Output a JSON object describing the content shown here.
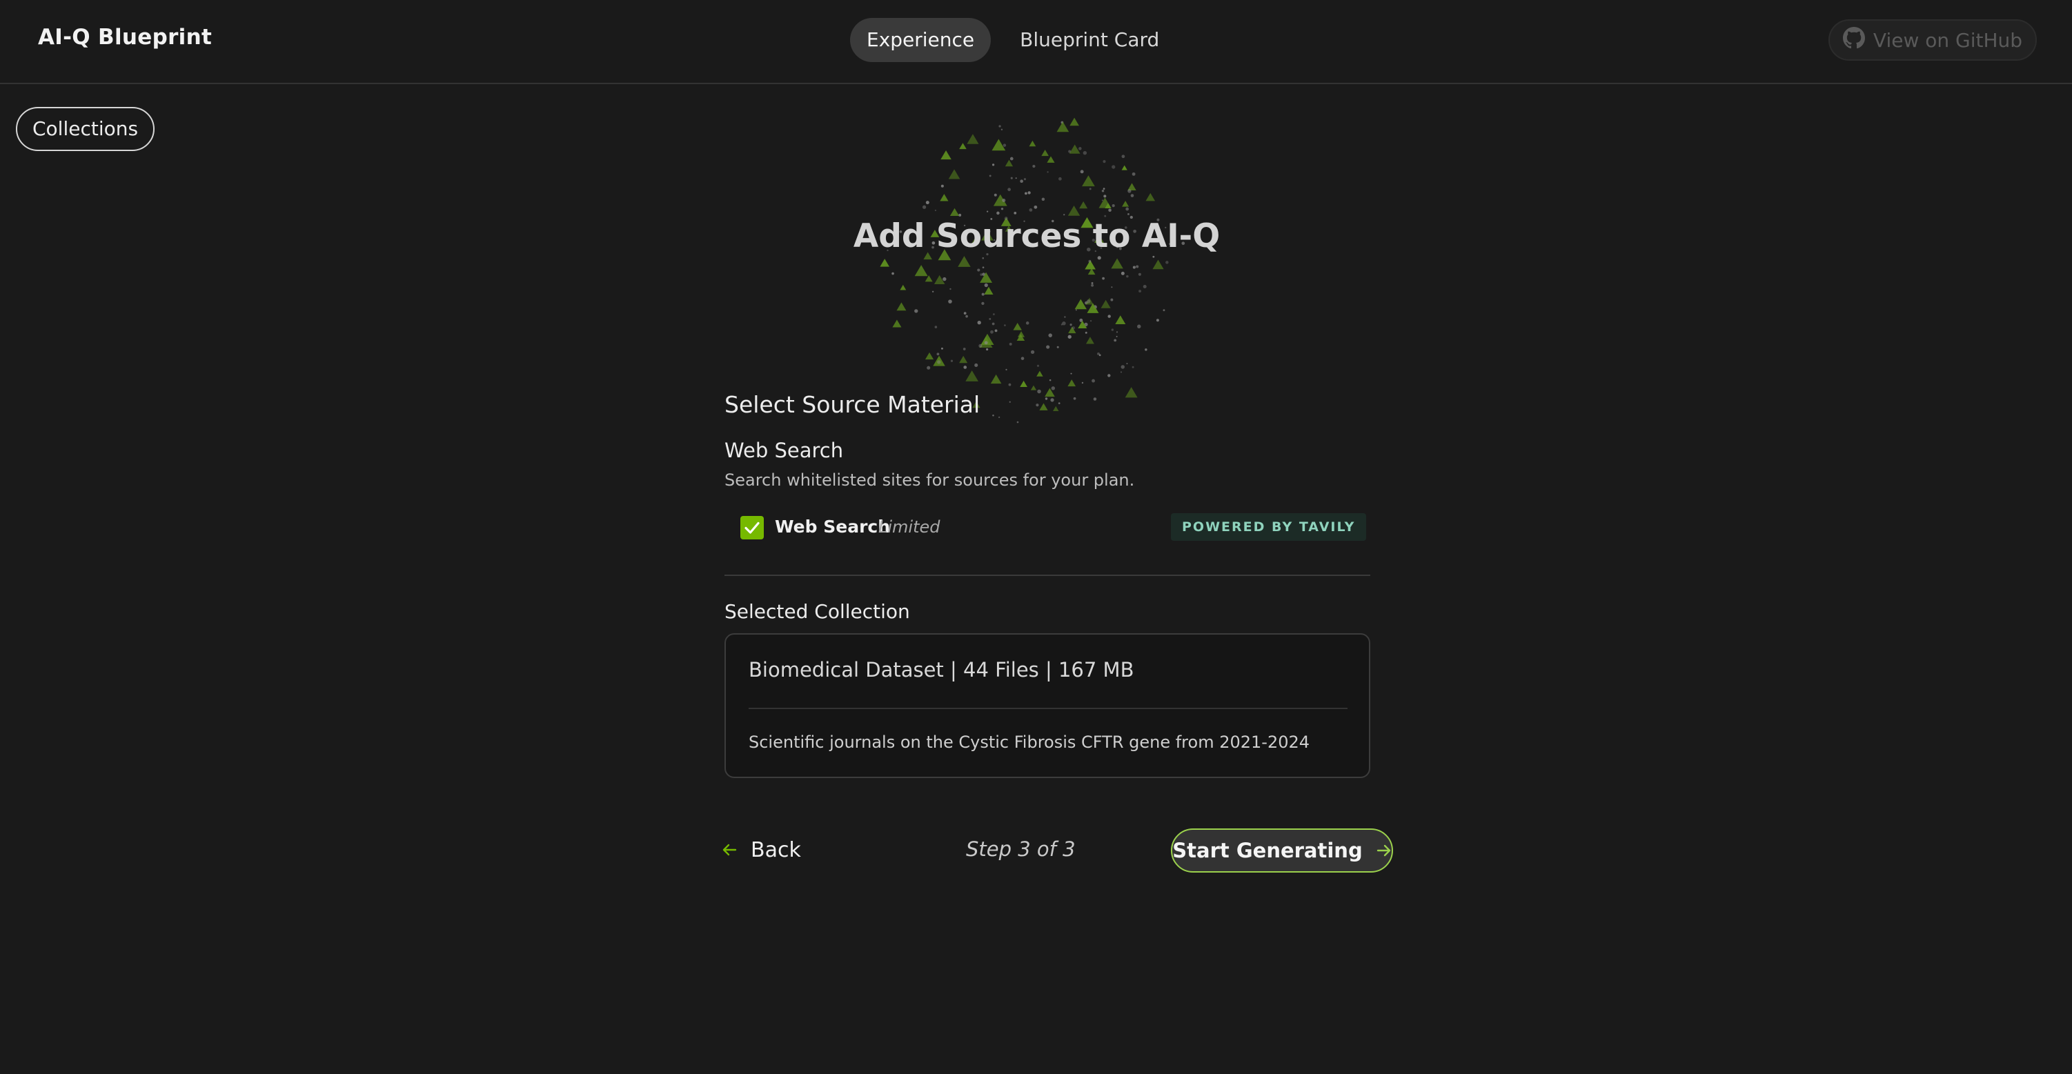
{
  "header": {
    "brand": "AI-Q Blueprint",
    "tabs": [
      {
        "label": "Experience",
        "active": true
      },
      {
        "label": "Blueprint Card",
        "active": false
      }
    ],
    "github_label": "View on GitHub",
    "github_icon": "github-icon"
  },
  "sidebar": {
    "collections_label": "Collections"
  },
  "hero": {
    "title": "Add Sources to AI-Q"
  },
  "sources": {
    "section_title": "Select Source Material",
    "web_search": {
      "title": "Web Search",
      "description": "Search whitelisted sites for sources for your plan.",
      "checkbox_label": "Web Search",
      "checkbox_note": "Limited",
      "checked": true,
      "badge": "POWERED BY TAVILY"
    },
    "collection": {
      "label": "Selected Collection",
      "summary": "Biomedical Dataset | 44 Files | 167 MB",
      "description": "Scientific journals on the Cystic Fibrosis CFTR gene from 2021-2024"
    }
  },
  "footer": {
    "back_label": "Back",
    "step_text": "Step 3 of 3",
    "start_label": "Start Generating"
  },
  "colors": {
    "background": "#1a1a1a",
    "accent": "#76b900",
    "accent_border": "#9bd14c",
    "badge_bg": "#1c2b26",
    "badge_text": "#8fd3bd"
  }
}
